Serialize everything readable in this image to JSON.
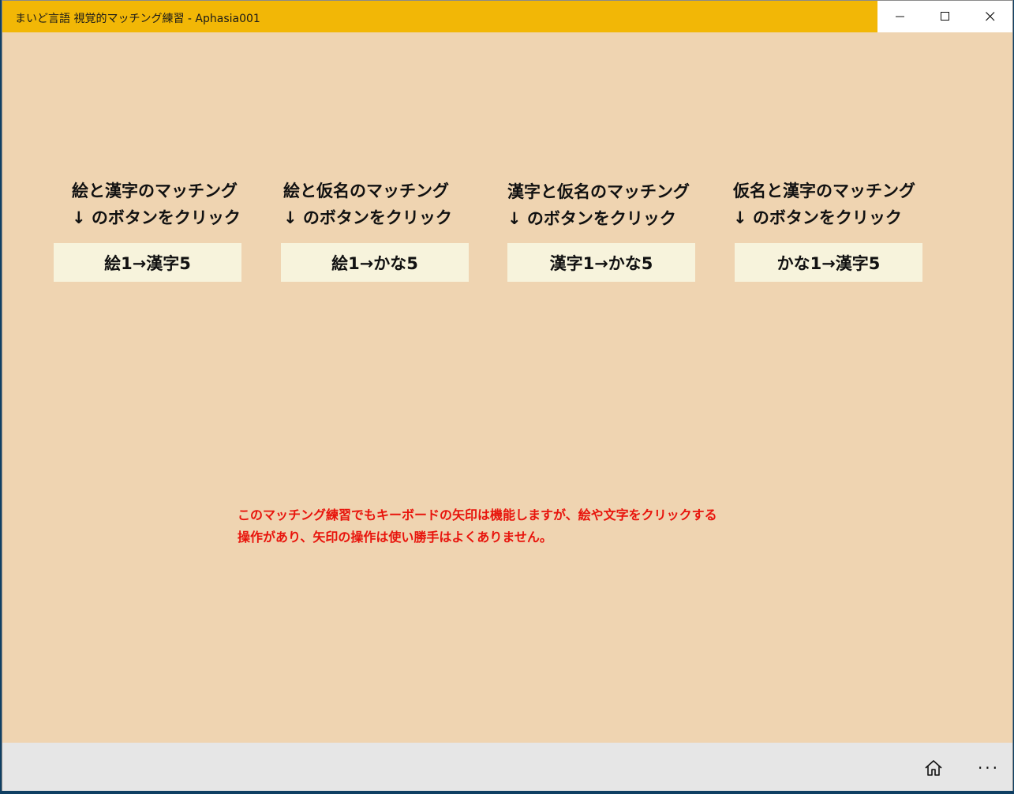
{
  "window": {
    "title": "まいど言語 視覚的マッチング練習 - Aphasia001",
    "title_bar_color": "#f2b706",
    "background_color": "#efd4b1"
  },
  "columns": [
    {
      "label_line1": "絵と漢字のマッチング",
      "label_line2": "↓ のボタンをクリック",
      "button_label": "絵1→漢字5"
    },
    {
      "label_line1": "絵と仮名のマッチング",
      "label_line2": "↓ のボタンをクリック",
      "button_label": "絵1→かな5"
    },
    {
      "label_line1": "漢字と仮名のマッチング",
      "label_line2": "↓ のボタンをクリック",
      "button_label": "漢字1→かな5"
    },
    {
      "label_line1": "仮名と漢字のマッチング",
      "label_line2": "↓ のボタンをクリック",
      "button_label": "かな1→漢字5"
    }
  ],
  "notice": {
    "text": "このマッチング練習でもキーボードの矢印は機能しますが、絵や文字をクリックする操作があり、矢印の操作は使い勝手はよくありません。",
    "color": "#e8140c"
  },
  "bottom_bar": {
    "home_icon": "home-icon",
    "more_label": "···"
  }
}
